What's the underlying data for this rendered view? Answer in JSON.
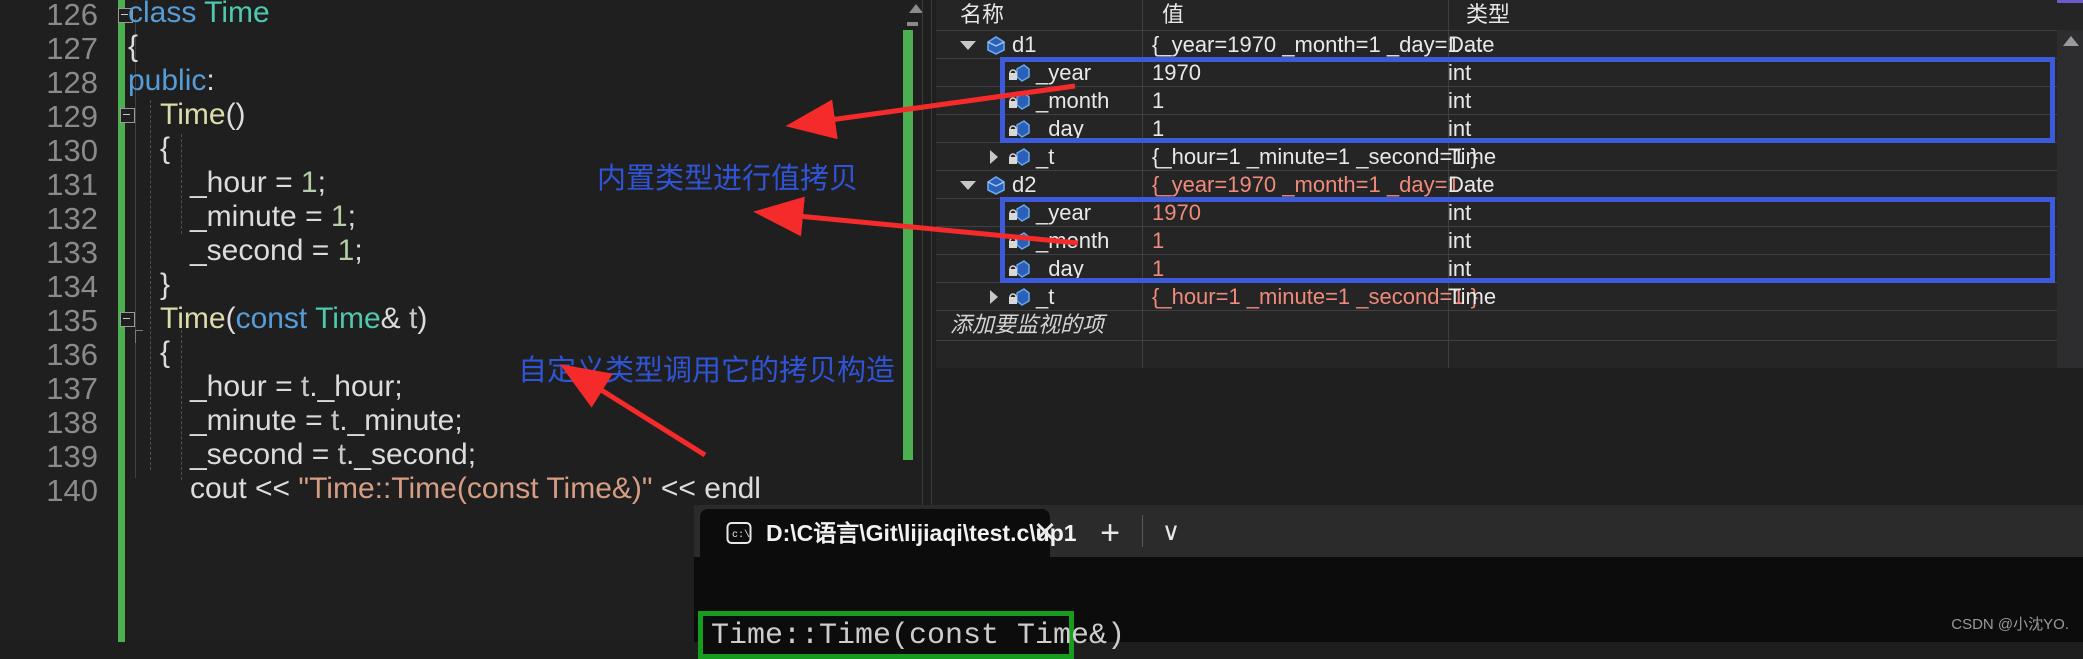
{
  "editor": {
    "lines": [
      {
        "num": "126",
        "text": "class Time"
      },
      {
        "num": "127",
        "text": "{"
      },
      {
        "num": "128",
        "text": "public:"
      },
      {
        "num": "129",
        "text": "Time()"
      },
      {
        "num": "130",
        "text": "{"
      },
      {
        "num": "131",
        "text": "_hour = 1;"
      },
      {
        "num": "132",
        "text": "_minute = 1;"
      },
      {
        "num": "133",
        "text": "_second = 1;"
      },
      {
        "num": "134",
        "text": "}"
      },
      {
        "num": "135",
        "text": "Time(const Time& t)"
      },
      {
        "num": "136",
        "text": "{"
      },
      {
        "num": "137",
        "text": "_hour = t._hour;"
      },
      {
        "num": "138",
        "text": "_minute = t._minute;"
      },
      {
        "num": "139",
        "text": "_second = t._second;"
      },
      {
        "num": "140",
        "text": "cout << \"Time::Time(const Time&)\" << endl"
      }
    ],
    "scrollbar": {
      "up_arrow": "scroll-up-arrow-icon"
    }
  },
  "watch": {
    "columns": {
      "name": "名称",
      "value": "值",
      "type": "类型"
    },
    "rows": [
      {
        "indent": 1,
        "expander": "open",
        "icon": "object-icon",
        "name": "d1",
        "value": "{_year=1970 _month=1 _day=1 ...",
        "type": "Date",
        "changed": false
      },
      {
        "indent": 2,
        "expander": "none",
        "icon": "field-lock-icon",
        "name": "_year",
        "value": "1970",
        "type": "int",
        "changed": false
      },
      {
        "indent": 2,
        "expander": "none",
        "icon": "field-lock-icon",
        "name": "_month",
        "value": "1",
        "type": "int",
        "changed": false
      },
      {
        "indent": 2,
        "expander": "none",
        "icon": "field-lock-icon",
        "name": "_day",
        "value": "1",
        "type": "int",
        "changed": false
      },
      {
        "indent": 2,
        "expander": "closed",
        "icon": "field-lock-icon",
        "name": "_t",
        "value": "{_hour=1 _minute=1 _second=1 }",
        "type": "Time",
        "changed": false
      },
      {
        "indent": 1,
        "expander": "open",
        "icon": "object-icon",
        "name": "d2",
        "value": "{_year=1970 _month=1 _day=1 ...",
        "type": "Date",
        "changed": true
      },
      {
        "indent": 2,
        "expander": "none",
        "icon": "field-lock-icon",
        "name": "_year",
        "value": "1970",
        "type": "int",
        "changed": true
      },
      {
        "indent": 2,
        "expander": "none",
        "icon": "field-lock-icon",
        "name": "_month",
        "value": "1",
        "type": "int",
        "changed": true
      },
      {
        "indent": 2,
        "expander": "none",
        "icon": "field-lock-icon",
        "name": "_day",
        "value": "1",
        "type": "int",
        "changed": true
      },
      {
        "indent": 2,
        "expander": "closed",
        "icon": "field-lock-icon",
        "name": "_t",
        "value": "{_hour=1 _minute=1 _second=1 }",
        "type": "Time",
        "changed": true
      }
    ],
    "add_row_placeholder": "添加要监视的项",
    "highlight_color": "#3b5bdb",
    "changed_color": "#f08a7a"
  },
  "annotations": {
    "note1": "内置类型进行值拷贝",
    "note2": "自定义类型调用它的拷贝构造",
    "arrow_color": "#f52b2b",
    "text_color": "#2f54d6"
  },
  "terminal": {
    "tab_title": "D:\\C语言\\Git\\lijiaqi\\test.c\\up1",
    "tab_icon": "cmd-prompt-icon",
    "close_label": "✕",
    "new_tab_label": "+",
    "dropdown_label": "∨",
    "output_line": "Time::Time(const Time&)",
    "highlight_color": "#179c1e"
  },
  "watermark": "CSDN @小沈YO."
}
